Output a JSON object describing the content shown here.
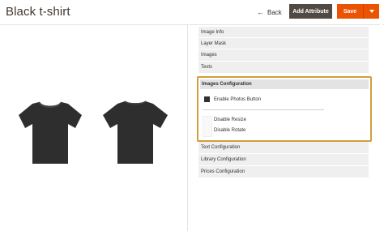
{
  "header": {
    "title": "Black t-shirt",
    "back_label": "Back",
    "back_arrow": "←",
    "add_attribute_label": "Add Attribute",
    "save_label": "Save"
  },
  "panel": {
    "rows_top": [
      "Image Info",
      "Layer Mask",
      "Images",
      "Texts"
    ],
    "config": {
      "title": "Images Configuration",
      "enable_photos_label": "Enable Photos Button",
      "disable_resize_label": "Disable Resize",
      "disable_rotate_label": "Disable Rotate"
    },
    "rows_bottom": [
      "Text Configuration",
      "Library Configuration",
      "Prices Configuration"
    ]
  },
  "colors": {
    "save": "#eb5202",
    "add_attribute": "#514943",
    "highlight_border": "#d29e3e",
    "shirt": "#2e2e2e"
  }
}
